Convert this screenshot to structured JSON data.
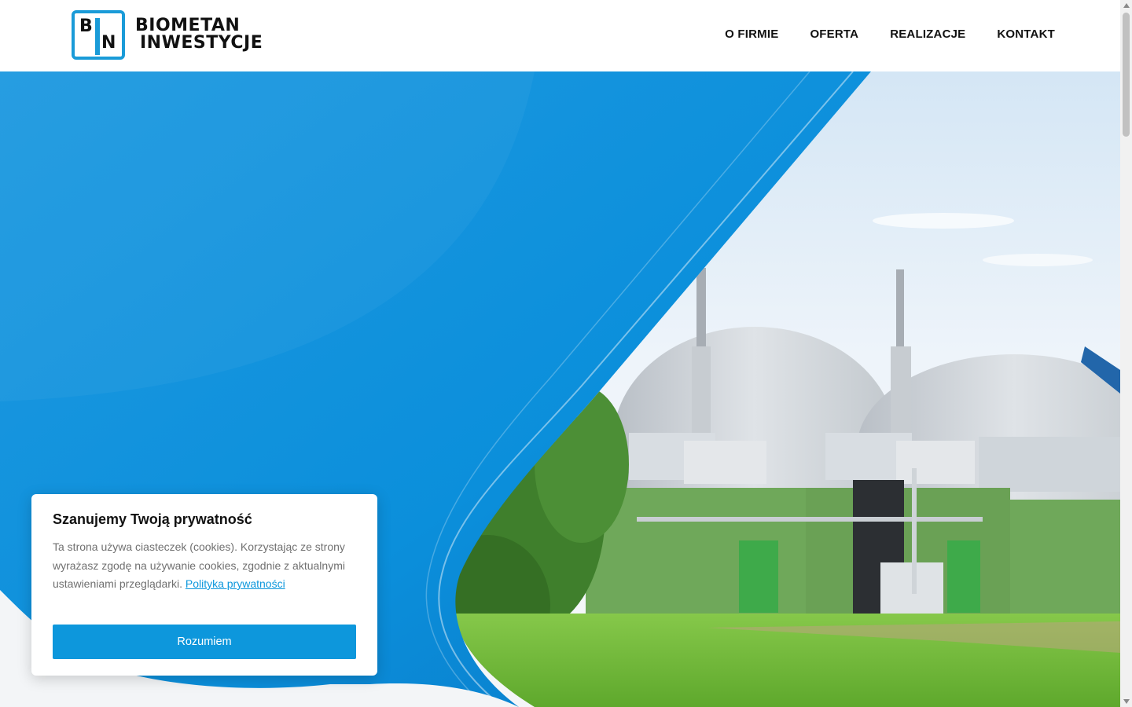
{
  "header": {
    "logo": {
      "mark_letters": [
        "B",
        "N"
      ],
      "line1": "BIOMETAN",
      "line2": "INWESTYCJE"
    },
    "nav": [
      "O FIRMIE",
      "OFERTA",
      "REALIZACJE",
      "KONTAKT"
    ]
  },
  "hero": {
    "accent_color": "#0b8fdb",
    "image_subject": "biogas-plant-photo"
  },
  "cookie": {
    "title": "Szanujemy Twoją prywatność",
    "text": "Ta strona używa ciasteczek (cookies). Korzystając ze strony wyrażasz zgodę na używanie cookies, zgodnie z aktualnymi ustawieniami przeglądarki.",
    "link": "Polityka prywatności",
    "button": "Rozumiem"
  }
}
